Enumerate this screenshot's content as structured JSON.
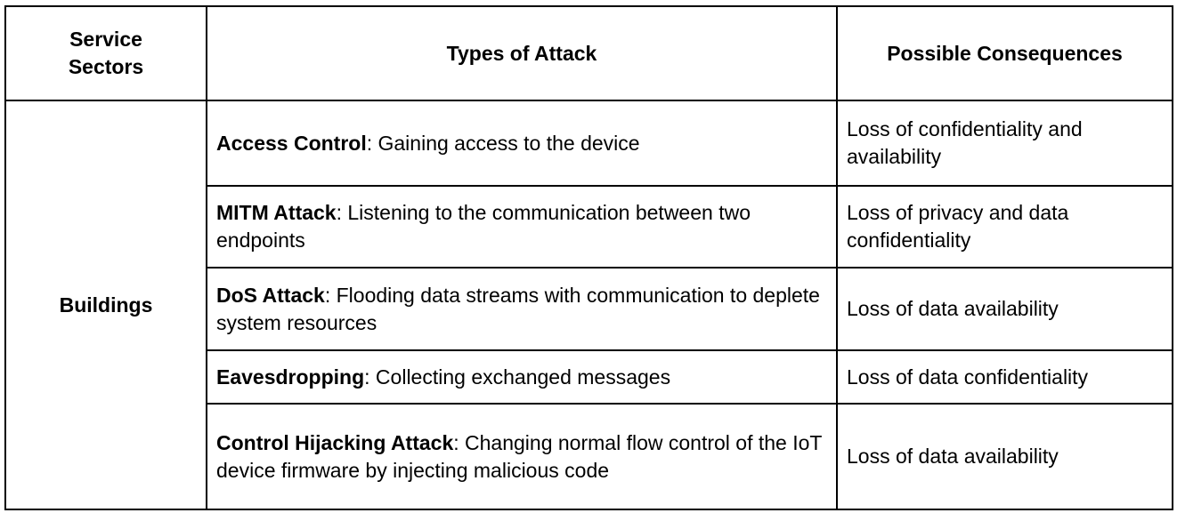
{
  "headers": {
    "sector_line1": "Service",
    "sector_line2": "Sectors",
    "types": "Types of Attack",
    "consequences": "Possible Consequences"
  },
  "sector": "Buildings",
  "rows": [
    {
      "name": "Access Control",
      "description": ": Gaining access to the device",
      "consequence": "Loss of confidentiality and availability"
    },
    {
      "name": "MITM Attack",
      "description": ": Listening to the communication between two endpoints",
      "consequence": "Loss of privacy and data confidentiality"
    },
    {
      "name": "DoS Attack",
      "description": ": Flooding data streams with communication to deplete system resources",
      "consequence": "Loss of data availability"
    },
    {
      "name": "Eavesdropping",
      "description": ": Collecting exchanged messages",
      "consequence": "Loss of data confidentiality"
    },
    {
      "name": "Control Hijacking Attack",
      "description": ": Changing normal flow control of the IoT device firmware by injecting malicious code",
      "consequence": "Loss of data availability"
    }
  ]
}
